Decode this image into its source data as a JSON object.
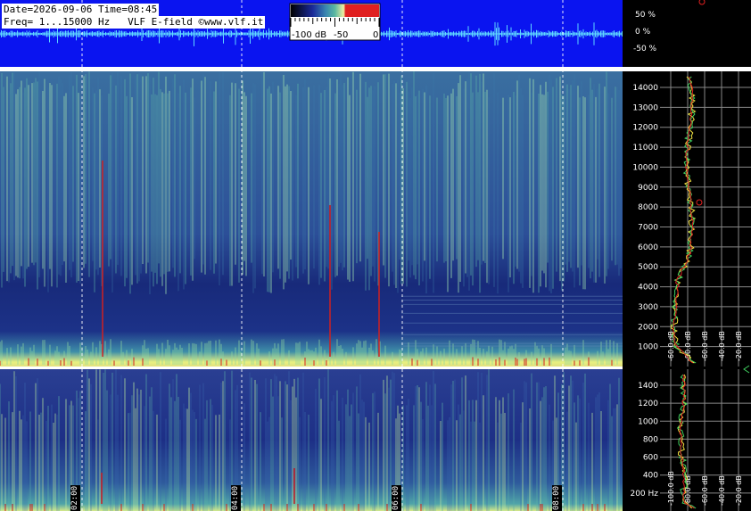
{
  "header": {
    "line1": "Date=2026-09-06 Time=08:45",
    "line2": "Freq= 1...15000 Hz   VLF E-field ©www.vlf.it"
  },
  "colorbar": {
    "labels": [
      "-100 dB",
      "-50",
      "0"
    ],
    "colors": [
      "#000000",
      "#1a2a9a",
      "#5ab8a0",
      "#f0f0a0",
      "#e02020"
    ]
  },
  "waveform": {
    "percent_labels": [
      "50 %",
      "0 %",
      "-50 %"
    ]
  },
  "spectrogram_top": {
    "freq_labels": [
      "14000",
      "13000",
      "12000",
      "11000",
      "10000",
      "9000",
      "8000",
      "7000",
      "6000",
      "5000",
      "4000",
      "3000",
      "2000",
      "1000"
    ],
    "db_labels": [
      "-60.0 dB",
      "-80.0 dB",
      "-60.0 dB",
      "-40.0 dB",
      "-20.0 dB"
    ]
  },
  "spectrogram_bottom": {
    "freq_labels": [
      "1400",
      "1200",
      "1000",
      "800",
      "600",
      "400",
      "200 Hz"
    ],
    "db_labels": [
      "-100.0 dB",
      "-80.0 dB",
      "-60.0 dB",
      "-40.0 dB",
      "-20.0 dB"
    ]
  },
  "time_labels": [
    "02:00",
    "04:00",
    "06:00",
    "08:00"
  ],
  "colors": {
    "wave_bg": "#0a14f0",
    "low_band": "#e8f080",
    "burst": "#d02020",
    "spectrum_line_a": "#f0e040",
    "spectrum_line_b": "#40d060",
    "spectrum_line_c": "#e02020"
  }
}
